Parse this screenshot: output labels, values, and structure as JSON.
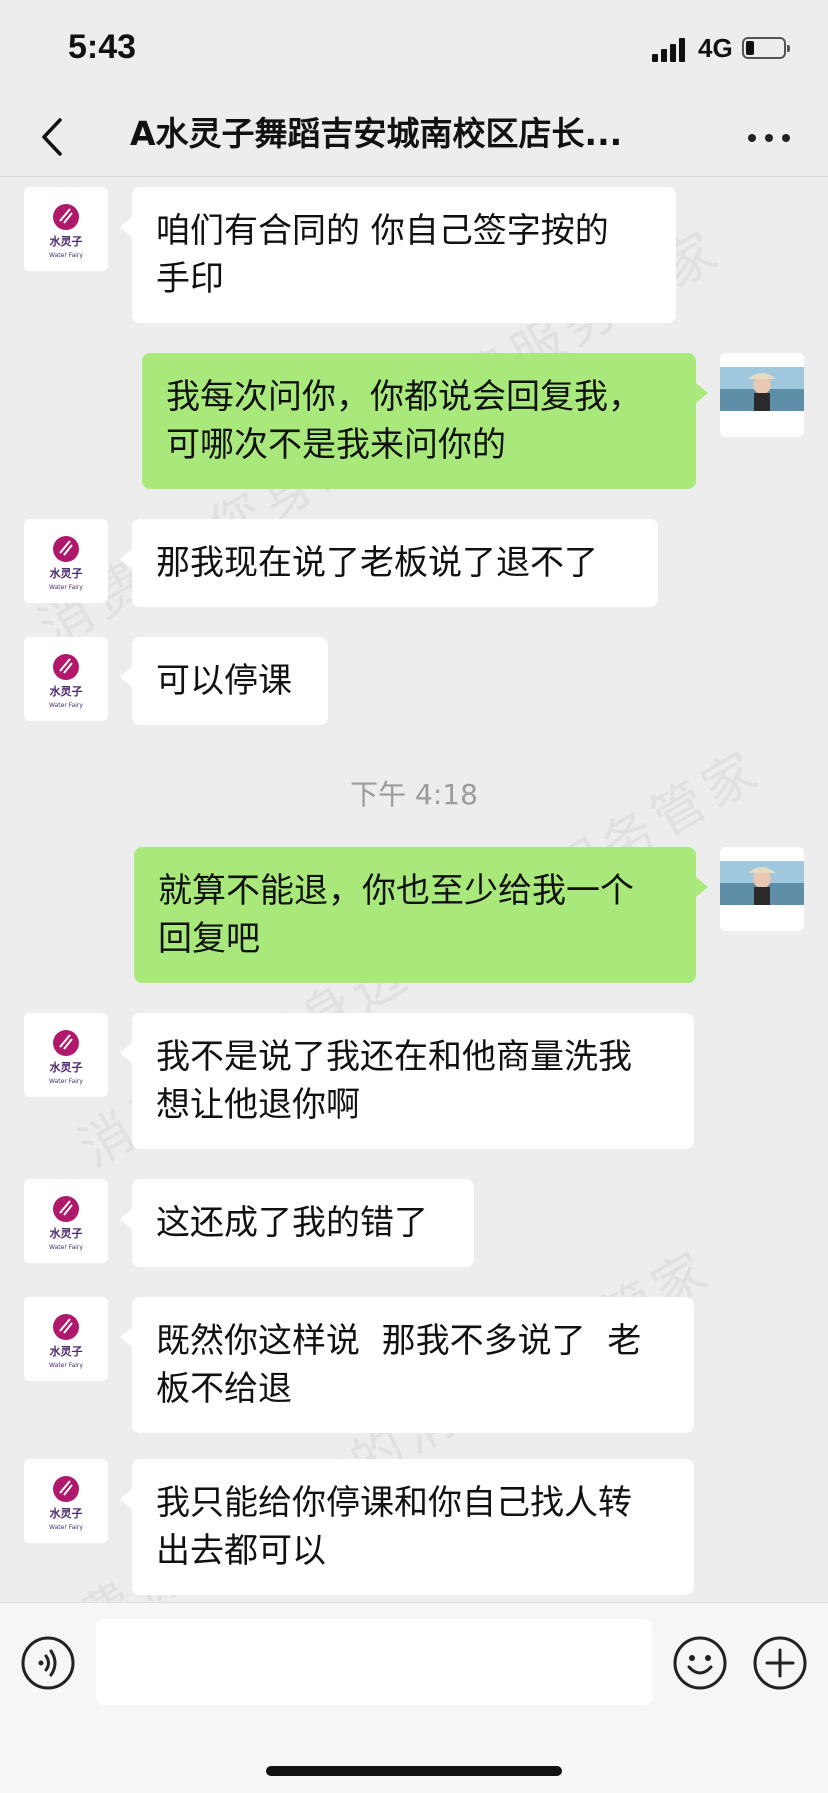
{
  "status_bar": {
    "time": "5:43",
    "network": "4G"
  },
  "header": {
    "title": "A水灵子舞蹈吉安城南校区店长..."
  },
  "shop_logo": {
    "name": "水灵子",
    "sub": "Water Fairy"
  },
  "messages": [
    {
      "side": "left",
      "text": "咱们有合同的 你自己签字按的\n手印"
    },
    {
      "side": "right",
      "text": "我每次问你，你都说会回复我，\n可哪次不是我来问你的"
    },
    {
      "side": "left",
      "text": "那我现在说了老板说了退不了"
    },
    {
      "side": "left",
      "text": "可以停课"
    },
    {
      "side": "right",
      "text": "就算不能退，你也至少给我一个\n回复吧"
    },
    {
      "side": "left",
      "text": "我不是说了我还在和他商量洗我\n想让他退你啊"
    },
    {
      "side": "left",
      "text": "这还成了我的错了"
    },
    {
      "side": "left",
      "text": "既然你这样说  那我不多说了  老\n板不给退"
    },
    {
      "side": "left",
      "text": "我只能给你停课和你自己找人转\n出去都可以"
    }
  ],
  "timestamp": "下午 4:18",
  "watermark": "消费保 您身边的消费服务管家",
  "colors": {
    "right_bubble": "#a9e97b",
    "left_bubble": "#ffffff",
    "background": "#ededed",
    "logo_pink": "#b0196b"
  }
}
